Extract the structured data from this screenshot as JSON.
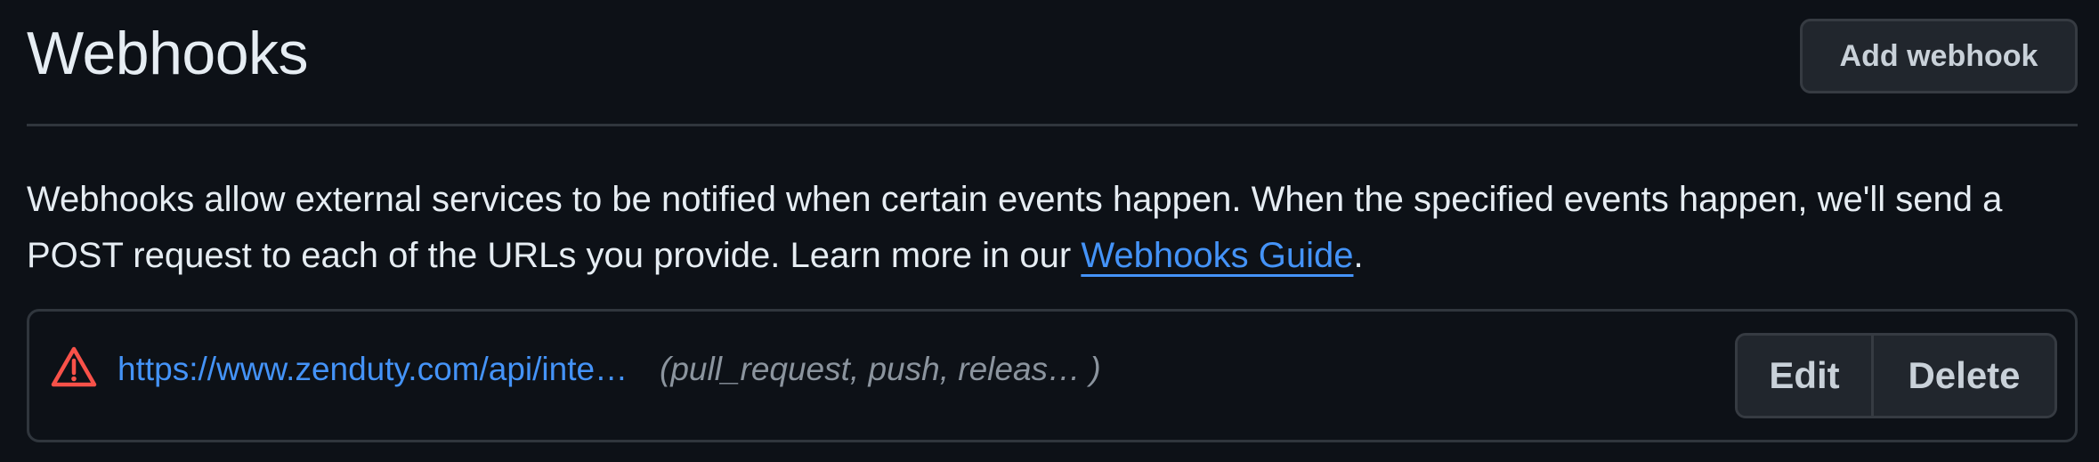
{
  "header": {
    "title": "Webhooks",
    "add_button_label": "Add webhook"
  },
  "description": {
    "text": "Webhooks allow external services to be notified when certain events happen. When the specified events happen, we'll send a POST request to each of the URLs you provide. Learn more in our ",
    "link_text": "Webhooks Guide",
    "suffix": "."
  },
  "webhooks": [
    {
      "status_icon": "alert-triangle-icon",
      "status_color": "#f85149",
      "url": "https://www.zenduty.com/api/inte…",
      "events": "(pull_request, push, releas…  )",
      "edit_label": "Edit",
      "delete_label": "Delete"
    }
  ],
  "colors": {
    "background": "#0d1117",
    "link": "#4493f8",
    "muted_text": "#8b949e",
    "border": "#30363d",
    "button_bg": "#21262d",
    "warning": "#f85149"
  }
}
